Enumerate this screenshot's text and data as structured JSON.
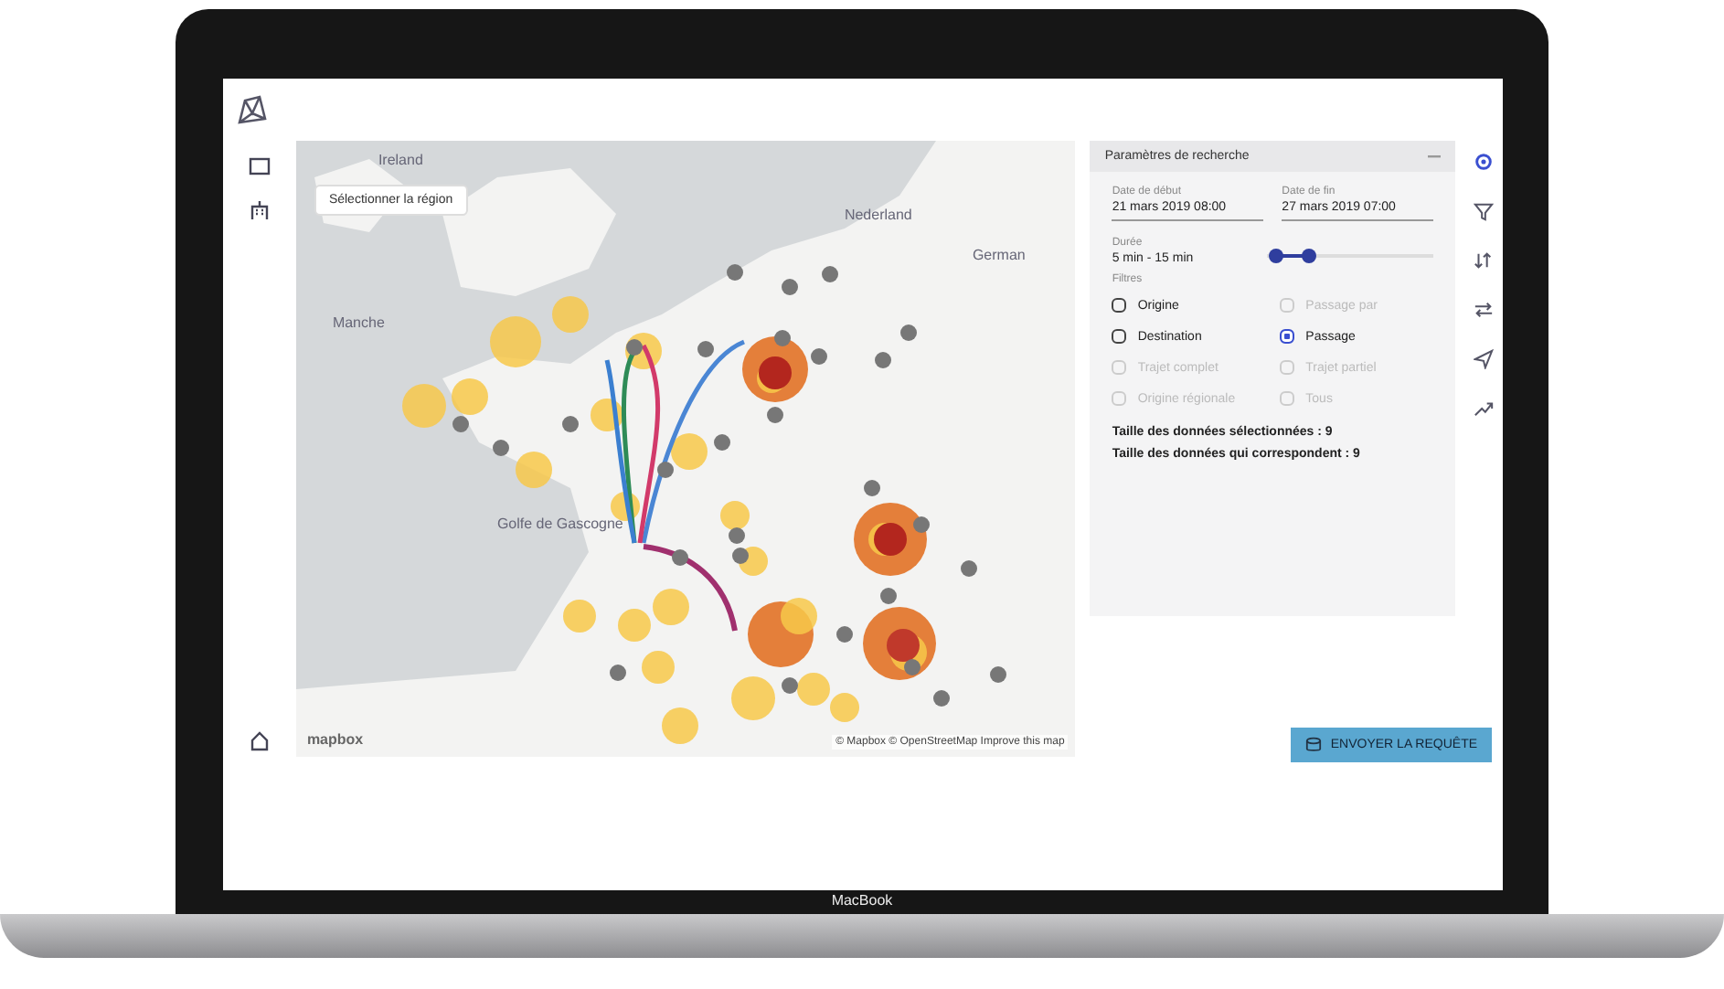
{
  "map": {
    "labels": [
      "Ireland",
      "Nederland",
      "German",
      "Manche",
      "Golfe de Gascogne"
    ],
    "region_button": "Sélectionner la région",
    "logo": "mapbox",
    "attribution": "© Mapbox © OpenStreetMap Improve this map"
  },
  "panel": {
    "title": "Paramètres de recherche",
    "dates": [
      {
        "label": "Date de début",
        "value": "21 mars 2019 08:00"
      },
      {
        "label": "Date de fin",
        "value": "27 mars 2019 07:00"
      }
    ],
    "duration": {
      "label": "Durée",
      "value": "5 min - 15 min",
      "thumbs": [
        {
          "level": 0.05
        },
        {
          "level": 0.25
        }
      ]
    },
    "filters_label": "Filtres",
    "filters": [
      {
        "label": "Origine",
        "checked": false,
        "disabled": false
      },
      {
        "label": "Passage par",
        "checked": false,
        "disabled": true
      },
      {
        "label": "Destination",
        "checked": false,
        "disabled": false
      },
      {
        "label": "Passage",
        "checked": true,
        "disabled": false
      },
      {
        "label": "Trajet complet",
        "checked": false,
        "disabled": true
      },
      {
        "label": "Trajet partiel",
        "checked": false,
        "disabled": true
      },
      {
        "label": "Origine régionale",
        "checked": false,
        "disabled": true
      },
      {
        "label": "Tous",
        "checked": false,
        "disabled": true
      }
    ],
    "stats": [
      "Taille des données sélectionnées : 9",
      "Taille des données qui correspondent : 9"
    ]
  },
  "submit_button": "ENVOYER LA REQUÊTE",
  "laptop_label": "MacBook"
}
